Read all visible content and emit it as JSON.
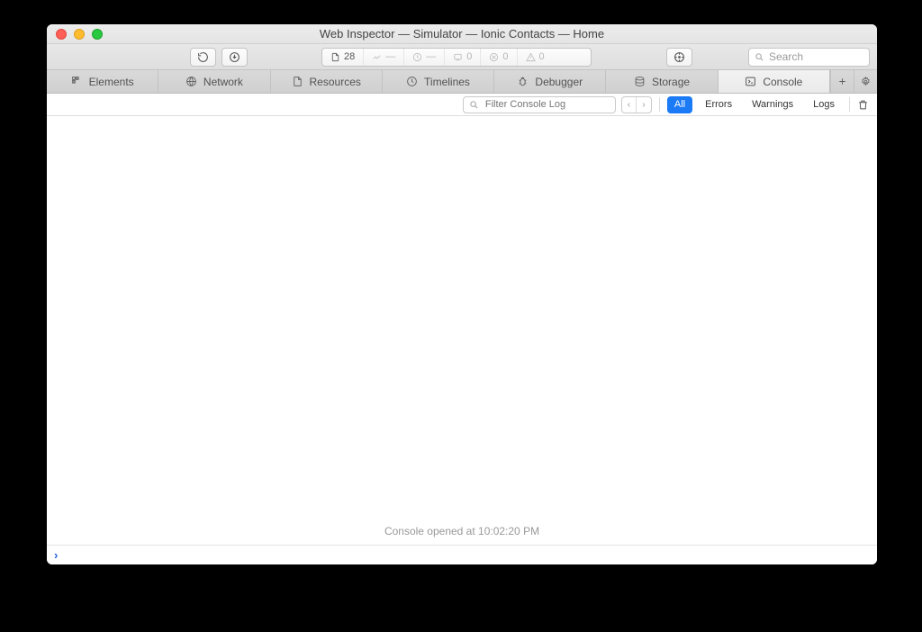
{
  "window": {
    "title": "Web Inspector — Simulator — Ionic Contacts — Home"
  },
  "toolbar": {
    "resource_count": "28",
    "time_label": "—",
    "log_count0": "0",
    "log_count1": "0",
    "log_count2": "0",
    "search_placeholder": "Search"
  },
  "tabs": {
    "elements": "Elements",
    "network": "Network",
    "resources": "Resources",
    "timelines": "Timelines",
    "debugger": "Debugger",
    "storage": "Storage",
    "console": "Console"
  },
  "filter": {
    "placeholder": "Filter Console Log",
    "all": "All",
    "errors": "Errors",
    "warnings": "Warnings",
    "logs": "Logs"
  },
  "console": {
    "opened_msg": "Console opened at 10:02:20 PM",
    "prompt": "›"
  }
}
